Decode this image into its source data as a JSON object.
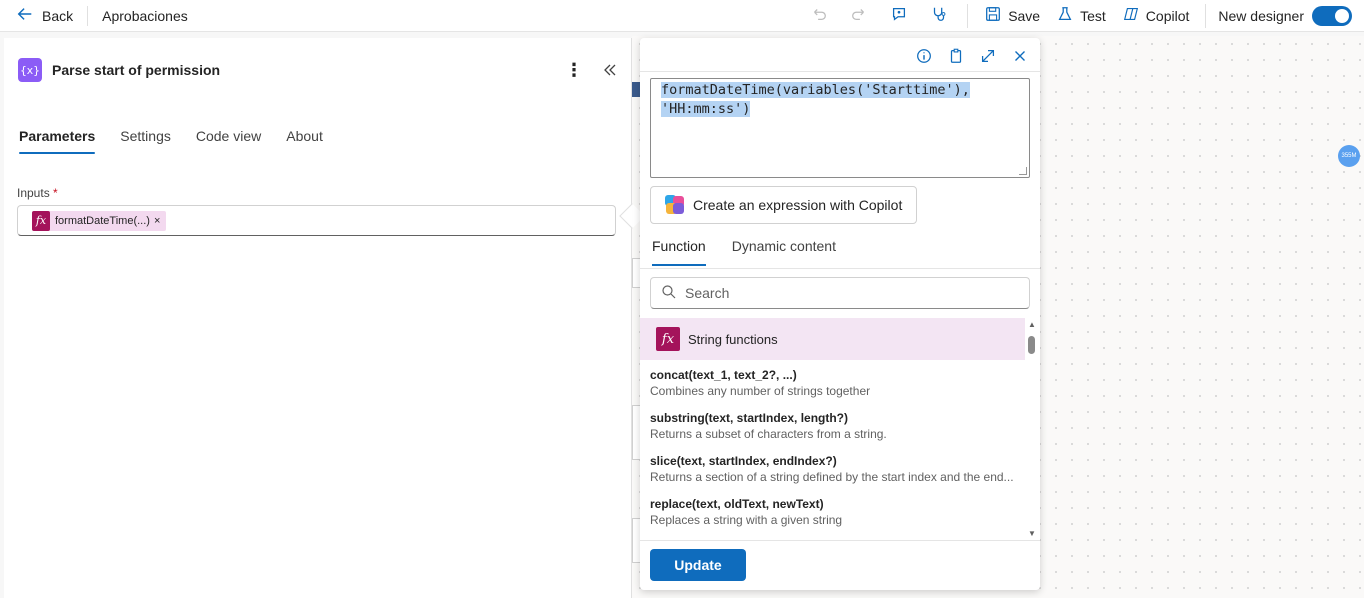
{
  "topbar": {
    "back_label": "Back",
    "flow_title": "Aprobaciones",
    "save_label": "Save",
    "test_label": "Test",
    "copilot_label": "Copilot",
    "new_designer_label": "New designer"
  },
  "action_panel": {
    "title": "Parse start of permission",
    "tabs": [
      "Parameters",
      "Settings",
      "Code view",
      "About"
    ],
    "active_tab": "Parameters",
    "inputs_label": "Inputs",
    "required_marker": "*",
    "token_label": "formatDateTime(...)",
    "token_remove": "×"
  },
  "expression_editor": {
    "expression_line1": "formatDateTime(variables('Starttime'),",
    "expression_line2": "'HH:mm:ss')",
    "copilot_button": "Create an expression with Copilot",
    "tabs": [
      "Function",
      "Dynamic content"
    ],
    "active_tab": "Function",
    "search_placeholder": "Search",
    "category": "String functions",
    "functions": [
      {
        "signature": "concat(text_1, text_2?, ...)",
        "description": "Combines any number of strings together"
      },
      {
        "signature": "substring(text, startIndex, length?)",
        "description": "Returns a subset of characters from a string."
      },
      {
        "signature": "slice(text, startIndex, endIndex?)",
        "description": "Returns a section of a string defined by the start index and the end..."
      },
      {
        "signature": "replace(text, oldText, newText)",
        "description": "Replaces a string with a given string"
      }
    ],
    "update_button": "Update"
  },
  "canvas": {
    "node_badge": "355M"
  },
  "colors": {
    "accent": "#0f6cbd",
    "fx_token": "#a4135b",
    "category_bg": "#f3e5f3",
    "action_icon": "#8b5cf6"
  }
}
